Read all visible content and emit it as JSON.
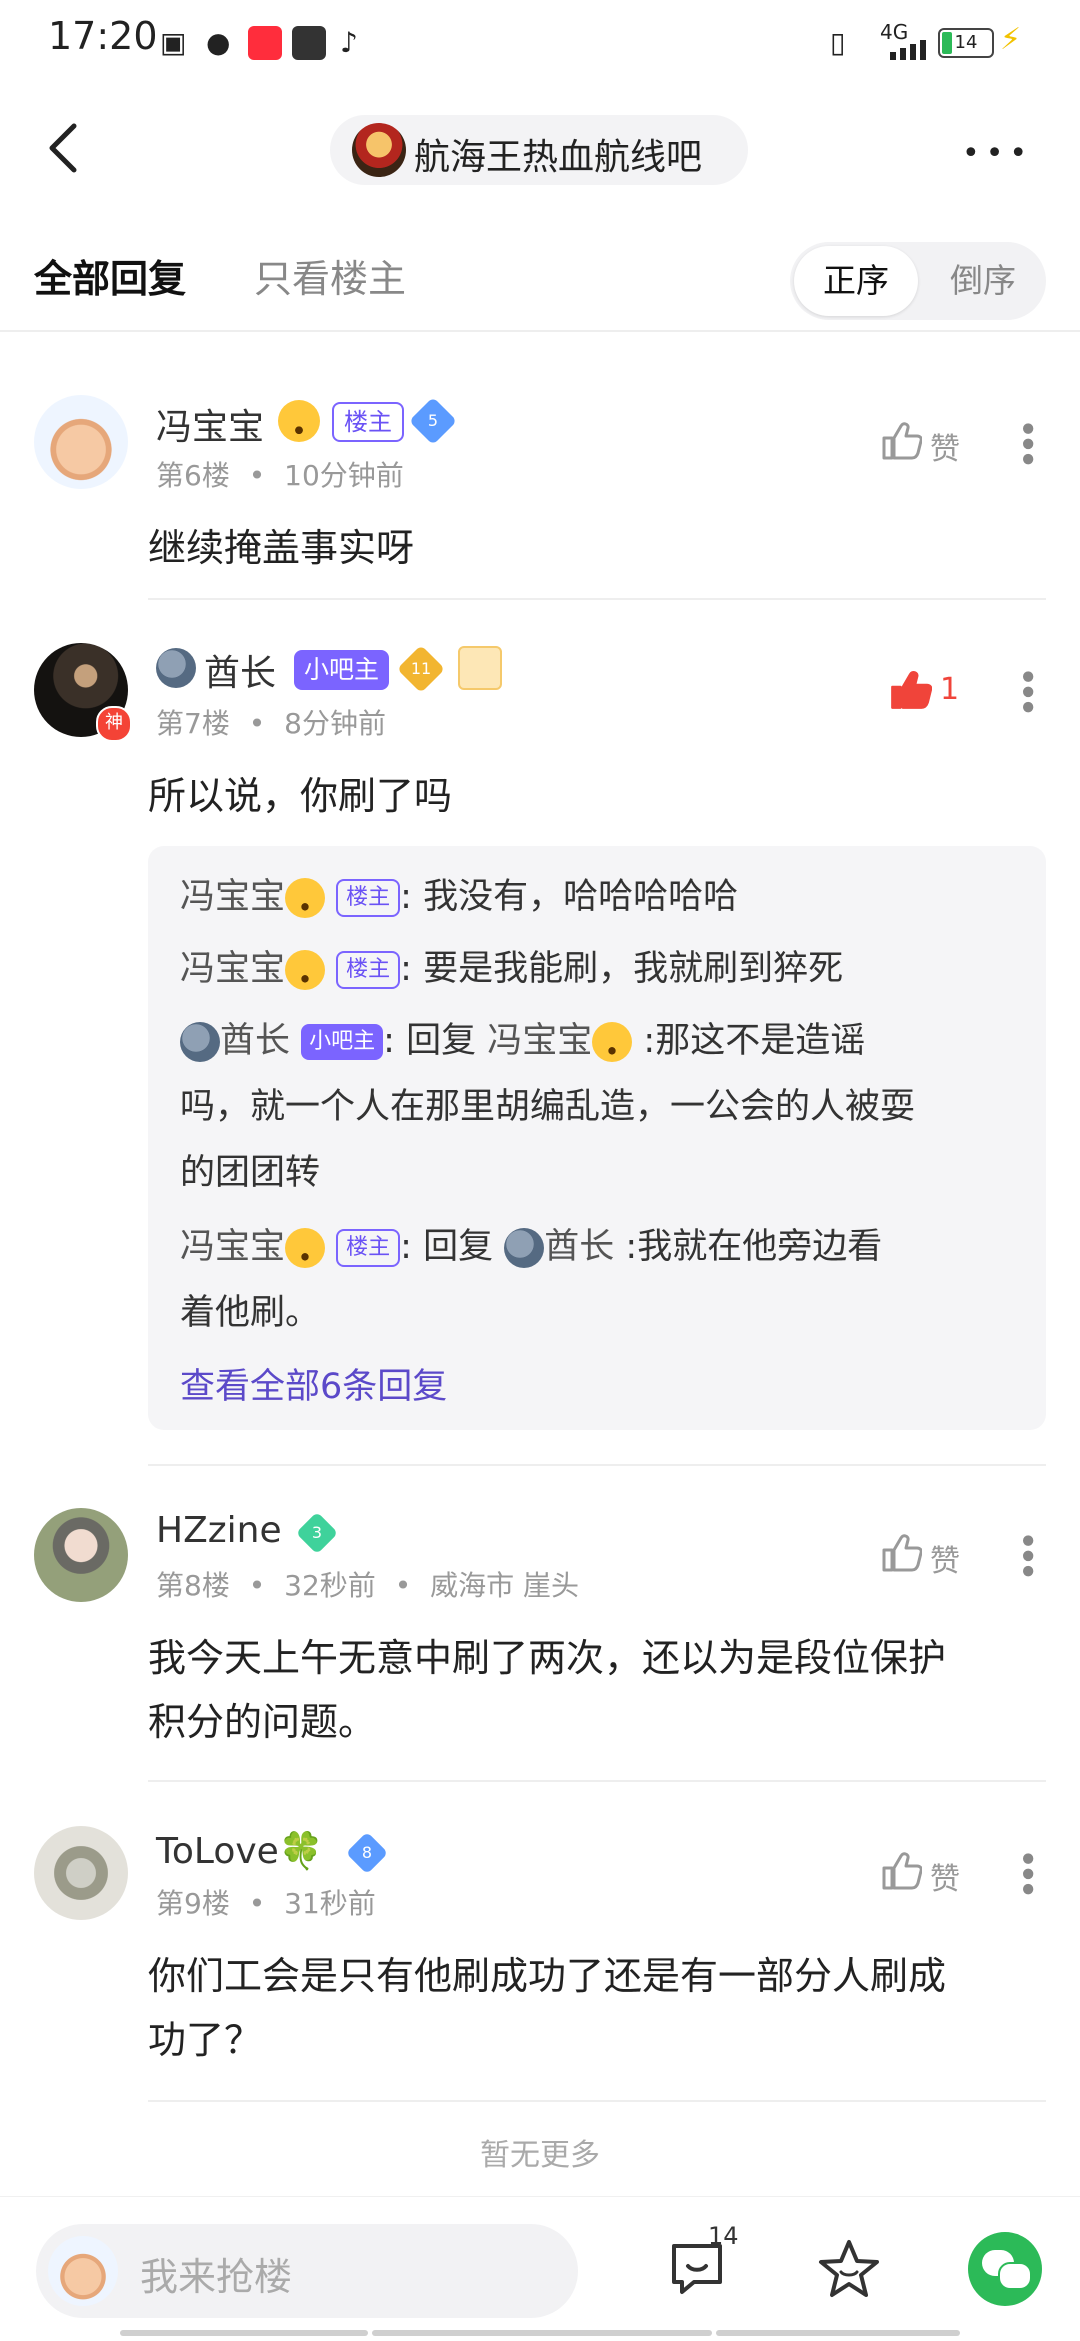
{
  "status_bar": {
    "time": "17:20",
    "network": "4G",
    "battery": "14"
  },
  "nav": {
    "forum_name": "航海王热血航线吧"
  },
  "tabs": {
    "all_replies": "全部回复",
    "only_op": "只看楼主",
    "sort_asc": "正序",
    "sort_desc": "倒序"
  },
  "posts": [
    {
      "name": "冯宝宝",
      "badge": "楼主",
      "level": "5",
      "floor": "第6楼",
      "time": "10分钟前",
      "location": "",
      "like_label": "赞",
      "content": "继续掩盖事实呀"
    },
    {
      "name": "酋长",
      "badge": "小吧主",
      "level": "11",
      "god_badge": "神",
      "floor": "第7楼",
      "time": "8分钟前",
      "like_count": "1",
      "content": "所以说，你刷了吗"
    },
    {
      "name": "HZzine",
      "level": "3",
      "floor": "第8楼",
      "time": "32秒前",
      "location": "威海市 崖头",
      "like_label": "赞",
      "content_line1": "我今天上午无意中刷了两次，还以为是段位保护",
      "content_line2": "积分的问题。"
    },
    {
      "name": "ToLove🍀",
      "level": "8",
      "floor": "第9楼",
      "time": "31秒前",
      "like_label": "赞",
      "content_line1": "你们工会是只有他刷成功了还是有一部分人刷成",
      "content_line2": "功了？"
    }
  ],
  "replies": {
    "r1": {
      "name": "冯宝宝",
      "badge": "楼主",
      "text": "我没有，哈哈哈哈哈"
    },
    "r2": {
      "name": "冯宝宝",
      "badge": "楼主",
      "text": "要是我能刷，我就刷到猝死"
    },
    "r3": {
      "name": "酋长",
      "badge": "小吧主",
      "prefix": "回复",
      "target": "冯宝宝",
      "text1": ":那这不是造谣",
      "text2": "吗，就一个人在那里胡编乱造，一公会的人被耍",
      "text3": "的团团转"
    },
    "r4": {
      "name": "冯宝宝",
      "badge": "楼主",
      "prefix": "回复",
      "target": "酋长",
      "text1": ":我就在他旁边看",
      "text2": "着他刷。"
    },
    "view_all": "查看全部6条回复"
  },
  "footer": {
    "no_more": "暂无更多",
    "input_placeholder": "我来抢楼",
    "comment_count": "14"
  },
  "colors": {
    "accent_purple": "#7b64ff",
    "like_red": "#f0443a",
    "wechat_green": "#2cba58"
  }
}
